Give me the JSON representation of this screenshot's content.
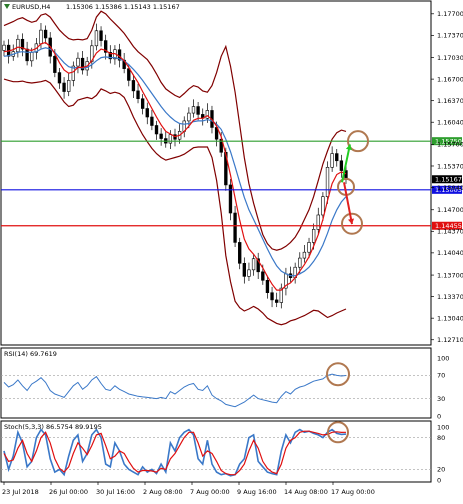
{
  "chart_data": {
    "type": "line",
    "header": {
      "symbol": "EURUSD,H4",
      "ohlc": "1.15306 1.15386 1.15143 1.15167"
    },
    "price_axis": {
      "ticks": [
        "1.17700",
        "1.17370",
        "1.17030",
        "1.16700",
        "1.16370",
        "1.16040",
        "1.15700",
        "1.15370",
        "1.15040",
        "1.14700",
        "1.14370",
        "1.14040",
        "1.13700",
        "1.13370",
        "1.13040",
        "1.12710"
      ],
      "ylim": [
        1.1266,
        1.1785
      ]
    },
    "x_axis": {
      "ticks": [
        "23 Jul 2018",
        "26 Jul 00:00",
        "30 Jul 16:00",
        "2 Aug 08:00",
        "7 Aug 00:00",
        "9 Aug 16:00",
        "14 Aug 08:00",
        "17 Aug 00:00"
      ]
    },
    "horizontal_levels": [
      {
        "name": "resistance",
        "price": 1.1575,
        "label": "1.15750",
        "color": "#2e9e2e"
      },
      {
        "name": "current",
        "price": 1.15167,
        "label": "1.15167",
        "color": "#000000"
      },
      {
        "name": "support-1",
        "price": 1.15005,
        "label": "1.15005",
        "color": "#1010e0"
      },
      {
        "name": "support-2",
        "price": 1.14455,
        "label": "1.14455",
        "color": "#e01010"
      }
    ],
    "price_series": {
      "close": [
        1.1722,
        1.1705,
        1.1712,
        1.1731,
        1.1716,
        1.1698,
        1.1711,
        1.1724,
        1.1745,
        1.1733,
        1.1705,
        1.168,
        1.1664,
        1.1651,
        1.1668,
        1.169,
        1.1702,
        1.1684,
        1.1697,
        1.1721,
        1.1744,
        1.1729,
        1.1711,
        1.1701,
        1.1715,
        1.1699,
        1.1686,
        1.1668,
        1.1652,
        1.164,
        1.1625,
        1.1612,
        1.1599,
        1.1586,
        1.1579,
        1.1572,
        1.1585,
        1.1578,
        1.159,
        1.1606,
        1.1618,
        1.1628,
        1.1616,
        1.161,
        1.1622,
        1.1596,
        1.1578,
        1.1558,
        1.1508,
        1.1465,
        1.142,
        1.1388,
        1.1368,
        1.1378,
        1.1395,
        1.1375,
        1.1362,
        1.1343,
        1.1332,
        1.1328,
        1.135,
        1.1372,
        1.1366,
        1.1382,
        1.1396,
        1.1405,
        1.142,
        1.144,
        1.1462,
        1.149,
        1.1535,
        1.1556,
        1.1545,
        1.153,
        1.15167
      ],
      "ma_fast": [
        1.1712,
        1.1713,
        1.1715,
        1.1719,
        1.1718,
        1.1715,
        1.1714,
        1.1717,
        1.1724,
        1.1726,
        1.172,
        1.1709,
        1.1695,
        1.1684,
        1.1679,
        1.1681,
        1.1688,
        1.1688,
        1.169,
        1.1698,
        1.171,
        1.1716,
        1.1714,
        1.1709,
        1.1709,
        1.1705,
        1.1698,
        1.1688,
        1.1676,
        1.1665,
        1.1651,
        1.1638,
        1.1625,
        1.1612,
        1.16,
        1.159,
        1.1586,
        1.1582,
        1.1584,
        1.159,
        1.1598,
        1.1607,
        1.161,
        1.161,
        1.1614,
        1.1608,
        1.1598,
        1.1582,
        1.1555,
        1.1523,
        1.1488,
        1.1454,
        1.1425,
        1.141,
        1.1402,
        1.1392,
        1.1381,
        1.1368,
        1.1356,
        1.1347,
        1.1347,
        1.1354,
        1.1358,
        1.1366,
        1.1376,
        1.1386,
        1.1398,
        1.1414,
        1.1432,
        1.1455,
        1.1484,
        1.151,
        1.1524,
        1.1528,
        1.1525
      ],
      "ma_slow": [
        1.1705,
        1.1706,
        1.1708,
        1.1711,
        1.1712,
        1.1711,
        1.1711,
        1.1712,
        1.1716,
        1.1718,
        1.1716,
        1.1711,
        1.1703,
        1.1695,
        1.1689,
        1.1687,
        1.1688,
        1.1687,
        1.1688,
        1.1692,
        1.1698,
        1.1703,
        1.1704,
        1.1703,
        1.1703,
        1.1701,
        1.1698,
        1.1692,
        1.1685,
        1.1677,
        1.1668,
        1.1658,
        1.1648,
        1.1638,
        1.1628,
        1.1619,
        1.1612,
        1.1606,
        1.1602,
        1.1601,
        1.1602,
        1.1605,
        1.1606,
        1.1606,
        1.1608,
        1.1606,
        1.1601,
        1.1593,
        1.1578,
        1.1559,
        1.1536,
        1.1512,
        1.1489,
        1.147,
        1.1455,
        1.144,
        1.1425,
        1.141,
        1.1396,
        1.1384,
        1.1376,
        1.1372,
        1.1369,
        1.1369,
        1.1372,
        1.1376,
        1.1382,
        1.1391,
        1.1402,
        1.1416,
        1.1434,
        1.1454,
        1.147,
        1.1482,
        1.149
      ],
      "bb_upper": [
        1.1752,
        1.1755,
        1.1758,
        1.1762,
        1.1764,
        1.176,
        1.1757,
        1.1759,
        1.1768,
        1.177,
        1.1765,
        1.1755,
        1.1745,
        1.1738,
        1.1732,
        1.173,
        1.1731,
        1.173,
        1.1732,
        1.1745,
        1.1765,
        1.1774,
        1.177,
        1.1762,
        1.1755,
        1.1748,
        1.174,
        1.173,
        1.172,
        1.1712,
        1.1706,
        1.17,
        1.169,
        1.1678,
        1.1665,
        1.1655,
        1.165,
        1.1645,
        1.1642,
        1.1648,
        1.1655,
        1.166,
        1.1658,
        1.1652,
        1.165,
        1.166,
        1.168,
        1.1705,
        1.172,
        1.169,
        1.165,
        1.16,
        1.155,
        1.151,
        1.148,
        1.1455,
        1.1432,
        1.1418,
        1.141,
        1.1408,
        1.141,
        1.1414,
        1.142,
        1.1428,
        1.144,
        1.1455,
        1.147,
        1.149,
        1.1515,
        1.154,
        1.156,
        1.1578,
        1.1588,
        1.1592,
        1.159
      ],
      "bb_lower": [
        1.167,
        1.1668,
        1.1666,
        1.1666,
        1.1667,
        1.1665,
        1.1664,
        1.1665,
        1.1666,
        1.1668,
        1.1664,
        1.1655,
        1.1645,
        1.1635,
        1.1628,
        1.163,
        1.1638,
        1.164,
        1.1642,
        1.164,
        1.1645,
        1.1655,
        1.1652,
        1.1648,
        1.165,
        1.1648,
        1.1642,
        1.1628,
        1.1612,
        1.1598,
        1.1585,
        1.1574,
        1.1564,
        1.1556,
        1.155,
        1.1546,
        1.1548,
        1.155,
        1.1552,
        1.1555,
        1.156,
        1.1565,
        1.1566,
        1.1566,
        1.1566,
        1.155,
        1.1515,
        1.1465,
        1.14,
        1.136,
        1.133,
        1.132,
        1.1315,
        1.1318,
        1.1322,
        1.1318,
        1.1312,
        1.1304,
        1.13,
        1.1296,
        1.1294,
        1.1296,
        1.13,
        1.1302,
        1.1305,
        1.1308,
        1.1312,
        1.1316,
        1.1315,
        1.131,
        1.1305,
        1.1308,
        1.1312,
        1.1315,
        1.1318
      ]
    },
    "rsi": {
      "label": "RSI(14) 69.7619",
      "ylim": [
        0,
        100
      ],
      "ticks": [
        "100",
        "70",
        "30",
        "0"
      ],
      "levels": [
        70,
        30
      ],
      "values": [
        58,
        50,
        54,
        62,
        52,
        44,
        55,
        60,
        66,
        58,
        44,
        38,
        35,
        32,
        42,
        52,
        58,
        46,
        52,
        62,
        68,
        56,
        46,
        44,
        52,
        46,
        42,
        38,
        36,
        34,
        33,
        32,
        31,
        30,
        32,
        30,
        42,
        38,
        44,
        50,
        54,
        56,
        46,
        44,
        52,
        36,
        30,
        26,
        20,
        18,
        16,
        20,
        24,
        30,
        36,
        30,
        28,
        26,
        24,
        23,
        34,
        42,
        38,
        46,
        50,
        52,
        56,
        60,
        62,
        64,
        70,
        72,
        70,
        69,
        69.76
      ]
    },
    "stoch": {
      "label": "Stoch(5,3,3) 86.5754 89.9195",
      "ylim": [
        0,
        100
      ],
      "ticks": [
        "100",
        "80",
        "20",
        "0"
      ],
      "levels": [
        80,
        20
      ],
      "main": [
        55,
        20,
        45,
        90,
        70,
        25,
        35,
        80,
        95,
        85,
        40,
        15,
        20,
        10,
        45,
        75,
        85,
        35,
        50,
        85,
        95,
        80,
        30,
        25,
        70,
        55,
        30,
        20,
        15,
        10,
        25,
        15,
        20,
        12,
        30,
        15,
        70,
        55,
        80,
        90,
        95,
        85,
        40,
        30,
        75,
        30,
        15,
        10,
        12,
        8,
        10,
        30,
        40,
        80,
        85,
        35,
        25,
        15,
        12,
        10,
        55,
        85,
        70,
        90,
        95,
        90,
        92,
        88,
        85,
        80,
        90,
        95,
        88,
        86,
        86.58
      ],
      "signal": [
        50,
        35,
        38,
        60,
        75,
        50,
        35,
        55,
        80,
        90,
        70,
        40,
        22,
        15,
        25,
        50,
        70,
        60,
        48,
        65,
        85,
        88,
        65,
        40,
        45,
        55,
        50,
        35,
        22,
        15,
        18,
        18,
        17,
        15,
        22,
        20,
        40,
        50,
        65,
        80,
        90,
        90,
        70,
        45,
        55,
        50,
        35,
        18,
        12,
        10,
        10,
        18,
        30,
        55,
        75,
        60,
        35,
        22,
        15,
        12,
        30,
        60,
        75,
        80,
        90,
        92,
        92,
        90,
        88,
        85,
        86,
        90,
        91,
        89.9,
        89.92
      ]
    },
    "annotations": [
      {
        "name": "target-circle",
        "shape": "circle",
        "color": "#b07850"
      },
      {
        "name": "entry-circle",
        "shape": "circle",
        "color": "#b07850"
      },
      {
        "name": "support-circle",
        "shape": "circle",
        "color": "#b07850"
      },
      {
        "name": "rsi-circle",
        "shape": "circle",
        "color": "#b07850"
      },
      {
        "name": "stoch-circle",
        "shape": "circle",
        "color": "#b07850"
      },
      {
        "name": "up-arrow",
        "shape": "arrow",
        "color": "#22cc22",
        "from_price": 1.1512,
        "to_price": 1.157
      },
      {
        "name": "down-arrow",
        "shape": "arrow",
        "color": "#e02020",
        "from_price": 1.1512,
        "to_price": 1.1448
      }
    ],
    "colors": {
      "candle": "#000000",
      "ma_fast": "#e01010",
      "ma_slow": "#3a78c8",
      "bollinger": "#800000",
      "rsi_line": "#3a78c8",
      "stoch_main": "#3a78c8",
      "stoch_signal": "#e01010",
      "level_dash": "#a0a0a0"
    }
  }
}
